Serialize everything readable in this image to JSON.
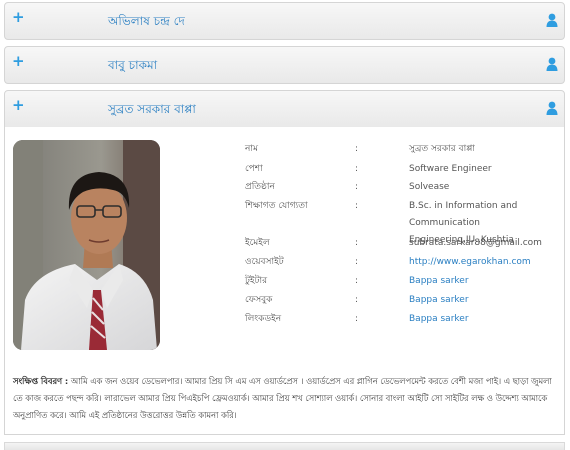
{
  "panels": [
    {
      "name": "অভিলাষ চন্দ্র দে"
    },
    {
      "name": "বাবু চাকমা"
    },
    {
      "name": "সুব্রত সরকার বাপ্পা"
    }
  ],
  "icons": {
    "expand": "plus-icon",
    "user": "user-icon"
  },
  "accent_color": "#2f9de0",
  "profile": {
    "rows": [
      {
        "label": "নাম",
        "colon": ":",
        "value": "সুব্রত সরকার বাপ্পা"
      },
      {
        "label": "পেশা",
        "colon": ":",
        "value": "Software Engineer"
      },
      {
        "label": "প্রতিষ্ঠান",
        "colon": ":",
        "value": "Solvease"
      },
      {
        "label": "শিক্ষাগত যোগ্যতা",
        "colon": ":",
        "value": "B.Sc. in Information and Communication Engineering,IU.,Kushtia"
      },
      {
        "label": "ইমেইল",
        "colon": ":",
        "value": "subrata.sarkar88@gmail.com"
      },
      {
        "label": "ওয়েবসাইট",
        "colon": ":",
        "value": "http://www.egarokhan.com"
      },
      {
        "label": "টুইটার",
        "colon": ":",
        "value": "Bappa sarker"
      },
      {
        "label": "ফেসবুক",
        "colon": ":",
        "value": "Bappa sarker"
      },
      {
        "label": "লিংকডইন",
        "colon": ":",
        "value": "Bappa sarker"
      }
    ],
    "bio_label": "সংক্ষিপ্ত বিবরণ :",
    "bio_text": "আমি এক জন ওয়েব ডেভেলপার। আমার প্রিয় সি এম এস ওয়ার্ডপ্রেস । ওয়ার্ডপ্রেস এর প্লাগিন ডেভেলপমেন্ট করতে বেশী মজা পাই। এ ছাড়া জুমলা তে কাজ করতে পছন্দ করি। লারাভেল আমার প্রিয় পিএইচপি ফ্রেমওয়ার্ক। আমার প্রিয় শখ সোশ্যাল ওয়ার্ক। সোনার বাংলা আইটি সো সাইটির লক্ষ ও উদ্দেশ্য আমাকে অনুপ্রাণিত করে। আমি এই প্রতিষ্ঠানের উত্তরোত্তর উন্নতি কামনা করি।"
  }
}
